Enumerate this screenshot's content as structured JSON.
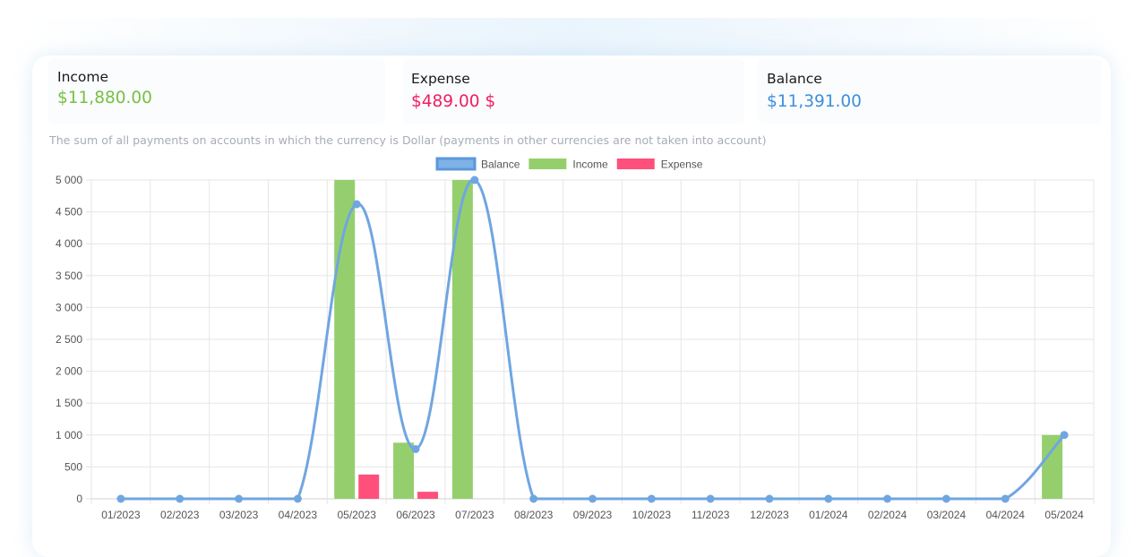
{
  "stats": {
    "income": {
      "label": "Income",
      "value": "$11,880.00",
      "color": "#77c043"
    },
    "expense": {
      "label": "Expense",
      "value": "$489.00 $",
      "color": "#ef1f5f"
    },
    "balance": {
      "label": "Balance",
      "value": "$11,391.00",
      "color": "#3d8fdc"
    }
  },
  "note": "The sum of all payments on accounts in which the currency is Dollar (payments in other currencies are not taken into account)",
  "chart_data": {
    "type": "bar",
    "title": "",
    "xlabel": "",
    "ylabel": "",
    "ylim": [
      0,
      5000
    ],
    "y_ticks": [
      "5 000",
      "4 500",
      "4 000",
      "3 500",
      "3 000",
      "2 500",
      "2 000",
      "1 500",
      "1 000",
      "500",
      "0"
    ],
    "grid": true,
    "legend_position": "top-center",
    "categories": [
      "01/2023",
      "02/2023",
      "03/2023",
      "04/2023",
      "05/2023",
      "06/2023",
      "07/2023",
      "08/2023",
      "09/2023",
      "10/2023",
      "11/2023",
      "12/2023",
      "01/2024",
      "02/2024",
      "03/2024",
      "04/2024",
      "05/2024"
    ],
    "series": [
      {
        "name": "Balance",
        "type": "line",
        "color": "#6fa6e0",
        "values": [
          0,
          0,
          0,
          0,
          4620,
          780,
          5000,
          0,
          0,
          0,
          0,
          0,
          0,
          0,
          0,
          0,
          1000
        ]
      },
      {
        "name": "Income",
        "type": "bar",
        "color": "#95cf6d",
        "values": [
          0,
          0,
          0,
          0,
          5000,
          880,
          5000,
          0,
          0,
          0,
          0,
          0,
          0,
          0,
          0,
          0,
          1000
        ]
      },
      {
        "name": "Expense",
        "type": "bar",
        "color": "#ff4f7b",
        "values": [
          0,
          0,
          0,
          0,
          380,
          110,
          0,
          0,
          0,
          0,
          0,
          0,
          0,
          0,
          0,
          0,
          0
        ]
      }
    ]
  }
}
